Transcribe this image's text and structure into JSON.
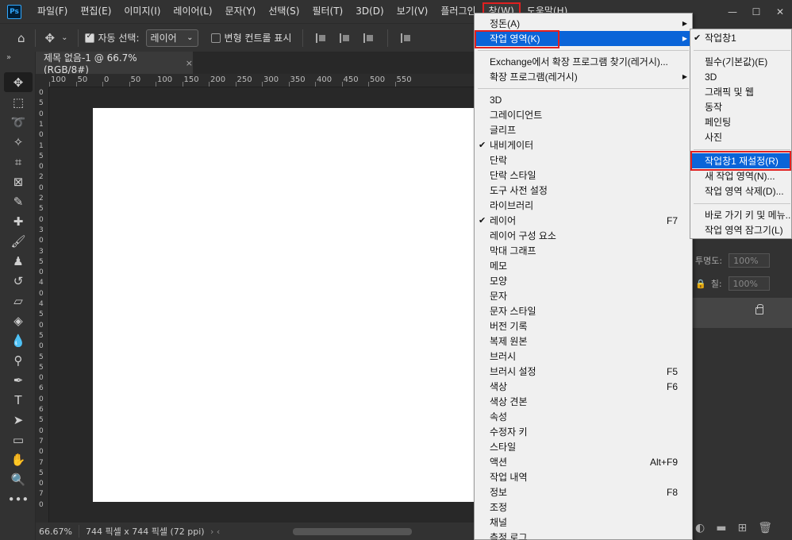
{
  "app": {
    "logo_text": "Ps",
    "menus": [
      "파일(F)",
      "편집(E)",
      "이미지(I)",
      "레이어(L)",
      "문자(Y)",
      "선택(S)",
      "필터(T)",
      "3D(D)",
      "보기(V)",
      "플러그인",
      "창(W)",
      "도움말(H)"
    ],
    "active_menu": "창(W)",
    "window_controls": [
      "—",
      "☐",
      "✕"
    ]
  },
  "options_bar": {
    "auto_select_label": "자동 선택:",
    "auto_select_checked": true,
    "layer_select_value": "레이어",
    "transform_controls_label": "변형 컨트롤 표시",
    "transform_controls_checked": false
  },
  "document": {
    "tab_title": "제목 없음-1 @ 66.7% (RGB/8#)",
    "close_symbol": "×",
    "ruler_labels": [
      "100",
      "50",
      "0",
      "50",
      "100",
      "150",
      "200",
      "250",
      "300",
      "350",
      "400",
      "450",
      "500",
      "550"
    ],
    "vruler_labels": [
      "0",
      "5",
      "0",
      "1",
      "0",
      "1",
      "5",
      "0",
      "2",
      "0",
      "2",
      "5",
      "0",
      "3",
      "0",
      "3",
      "5",
      "0",
      "4",
      "0",
      "4",
      "5",
      "0",
      "5",
      "0",
      "5",
      "5",
      "0",
      "6",
      "0",
      "6",
      "5",
      "0",
      "7",
      "0",
      "7",
      "5",
      "0",
      "7",
      "0"
    ]
  },
  "status": {
    "zoom": "66.67%",
    "doc_size": "744 픽셀 x 744 픽셀 (72 ppi)"
  },
  "layers_panel": {
    "opacity_label": "투명도:",
    "opacity_value": "100%",
    "fill_label": "칠:",
    "fill_value": "100%"
  },
  "window_menu": {
    "items": [
      {
        "label": "정돈(A)",
        "submenu": true
      },
      {
        "label": "작업 영역(K)",
        "submenu": true,
        "highlighted": true
      },
      {
        "label": "Exchange에서 확장 프로그램 찾기(레거시)..."
      },
      {
        "label": "확장 프로그램(레거시)",
        "submenu": true
      },
      {
        "label": "3D"
      },
      {
        "label": "그레이디언트"
      },
      {
        "label": "글리프"
      },
      {
        "label": "내비게이터",
        "checked": true
      },
      {
        "label": "단락"
      },
      {
        "label": "단락 스타일"
      },
      {
        "label": "도구 사전 설정"
      },
      {
        "label": "라이브러리"
      },
      {
        "label": "레이어",
        "checked": true,
        "shortcut": "F7"
      },
      {
        "label": "레이어 구성 요소"
      },
      {
        "label": "막대 그래프"
      },
      {
        "label": "메모"
      },
      {
        "label": "모양"
      },
      {
        "label": "문자"
      },
      {
        "label": "문자 스타일"
      },
      {
        "label": "버전 기록"
      },
      {
        "label": "복제 원본"
      },
      {
        "label": "브러시"
      },
      {
        "label": "브러시 설정",
        "shortcut": "F5"
      },
      {
        "label": "색상",
        "shortcut": "F6"
      },
      {
        "label": "색상 견본"
      },
      {
        "label": "속성"
      },
      {
        "label": "수정자 키"
      },
      {
        "label": "스타일"
      },
      {
        "label": "액션",
        "shortcut": "Alt+F9"
      },
      {
        "label": "작업 내역"
      },
      {
        "label": "정보",
        "shortcut": "F8"
      },
      {
        "label": "조정"
      },
      {
        "label": "채널"
      },
      {
        "label": "측정 로그"
      }
    ]
  },
  "workspace_submenu": {
    "items": [
      {
        "label": "작업창1",
        "checked": true
      },
      {
        "label": "필수(기본값)(E)"
      },
      {
        "label": "3D"
      },
      {
        "label": "그래픽 및 웹"
      },
      {
        "label": "동작"
      },
      {
        "label": "페인팅"
      },
      {
        "label": "사진"
      },
      {
        "label": "작업창1 재설정(R)",
        "highlighted": true
      },
      {
        "label": "새 작업 영역(N)..."
      },
      {
        "label": "작업 영역 삭제(D)..."
      },
      {
        "label": "바로 가기 키 및 메뉴..."
      },
      {
        "label": "작업 영역 잠그기(L)"
      }
    ]
  },
  "colors": {
    "highlight": "#0a64d8",
    "callout_border": "#e02020",
    "app_bg": "#323232"
  }
}
